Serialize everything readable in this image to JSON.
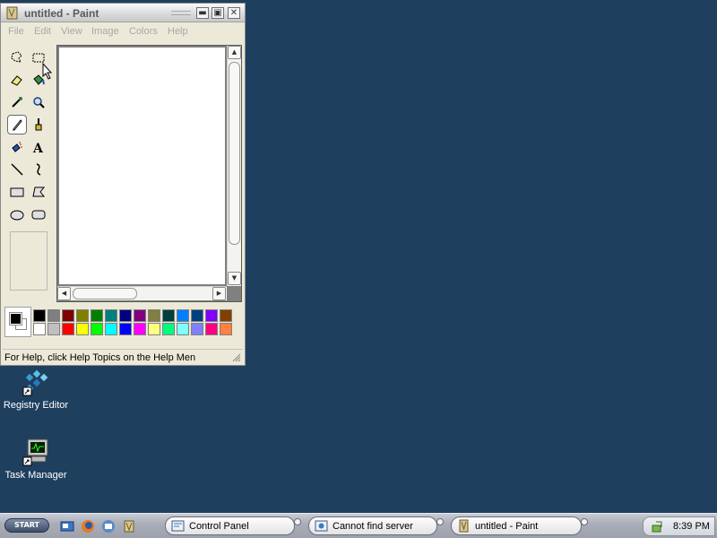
{
  "window": {
    "title": "untitled - Paint",
    "controls": {
      "minimize": "▬",
      "maximize": "▣",
      "close": "✕"
    }
  },
  "menu": [
    "File",
    "Edit",
    "View",
    "Image",
    "Colors",
    "Help"
  ],
  "tools": [
    "free-form-select-icon",
    "select-icon",
    "eraser-icon",
    "fill-with-color-icon",
    "pick-color-icon",
    "magnifier-icon",
    "pencil-icon",
    "brush-icon",
    "airbrush-icon",
    "text-icon",
    "line-icon",
    "curve-icon",
    "rectangle-icon",
    "polygon-icon",
    "ellipse-icon",
    "rounded-rectangle-icon"
  ],
  "active_tool": "pencil-icon",
  "text_tool_glyph": "A",
  "palette": {
    "foreground": "#000000",
    "background": "#ffffff",
    "row1": [
      "#000000",
      "#808080",
      "#800000",
      "#808000",
      "#008000",
      "#008080",
      "#000080",
      "#800080",
      "#808040",
      "#004040",
      "#0080ff",
      "#004080",
      "#8000ff",
      "#804000"
    ],
    "row2": [
      "#ffffff",
      "#c0c0c0",
      "#ff0000",
      "#ffff00",
      "#00ff00",
      "#00ffff",
      "#0000ff",
      "#ff00ff",
      "#ffff80",
      "#00ff80",
      "#80ffff",
      "#8080ff",
      "#ff0080",
      "#ff8040"
    ]
  },
  "status": {
    "text": "For Help, click Help Topics on the Help Men"
  },
  "desktop": {
    "icons": [
      {
        "label": "Registry Editor"
      },
      {
        "label": "Task Manager"
      }
    ]
  },
  "taskbar": {
    "start_label": "START",
    "tasks": [
      {
        "label": "Control Panel"
      },
      {
        "label": "Cannot find server"
      },
      {
        "label": "untitled - Paint"
      }
    ],
    "clock": "8:39 PM"
  }
}
